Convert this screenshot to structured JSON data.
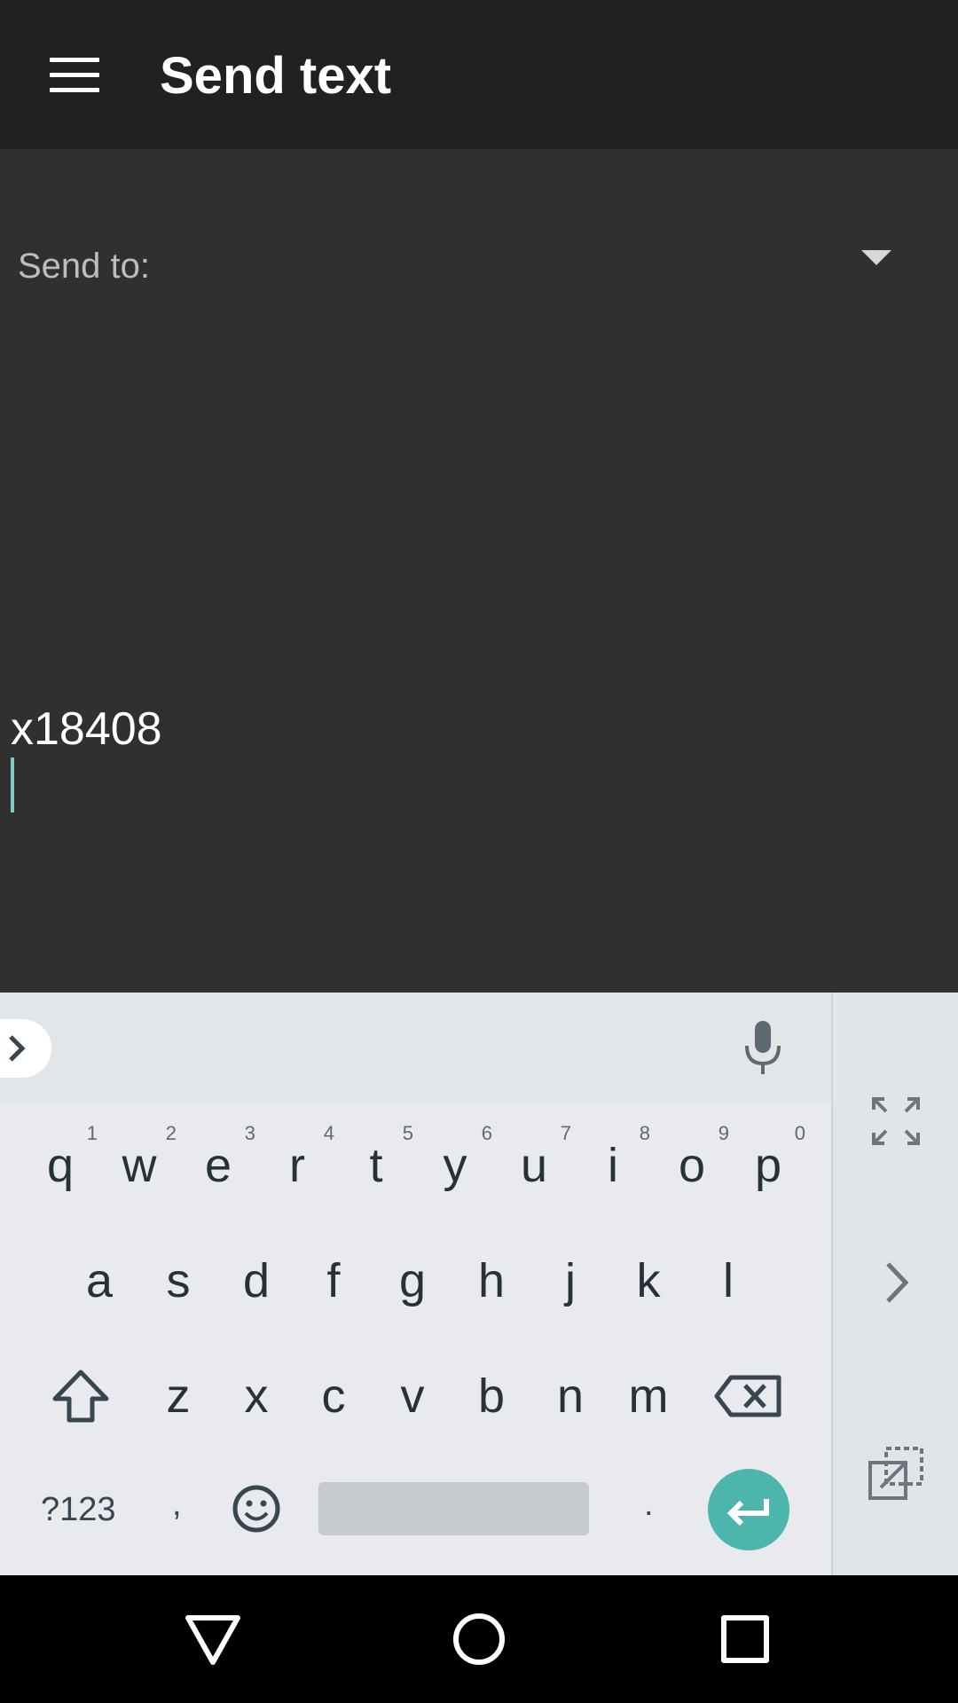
{
  "app_bar": {
    "title": "Send text",
    "menu_icon": "hamburger-menu-icon"
  },
  "form": {
    "send_to_label": "Send to:",
    "message_value": "x18408"
  },
  "keyboard": {
    "row1": [
      {
        "key": "q",
        "hint": "1"
      },
      {
        "key": "w",
        "hint": "2"
      },
      {
        "key": "e",
        "hint": "3"
      },
      {
        "key": "r",
        "hint": "4"
      },
      {
        "key": "t",
        "hint": "5"
      },
      {
        "key": "y",
        "hint": "6"
      },
      {
        "key": "u",
        "hint": "7"
      },
      {
        "key": "i",
        "hint": "8"
      },
      {
        "key": "o",
        "hint": "9"
      },
      {
        "key": "p",
        "hint": "0"
      }
    ],
    "row2": [
      "a",
      "s",
      "d",
      "f",
      "g",
      "h",
      "j",
      "k",
      "l"
    ],
    "row3": [
      "z",
      "x",
      "c",
      "v",
      "b",
      "n",
      "m"
    ],
    "symbols_label": "?123",
    "comma": ",",
    "period": "."
  },
  "colors": {
    "app_bar": "#212121",
    "background": "#303030",
    "accent": "#4db6ac",
    "keyboard": "#e8eaed"
  }
}
